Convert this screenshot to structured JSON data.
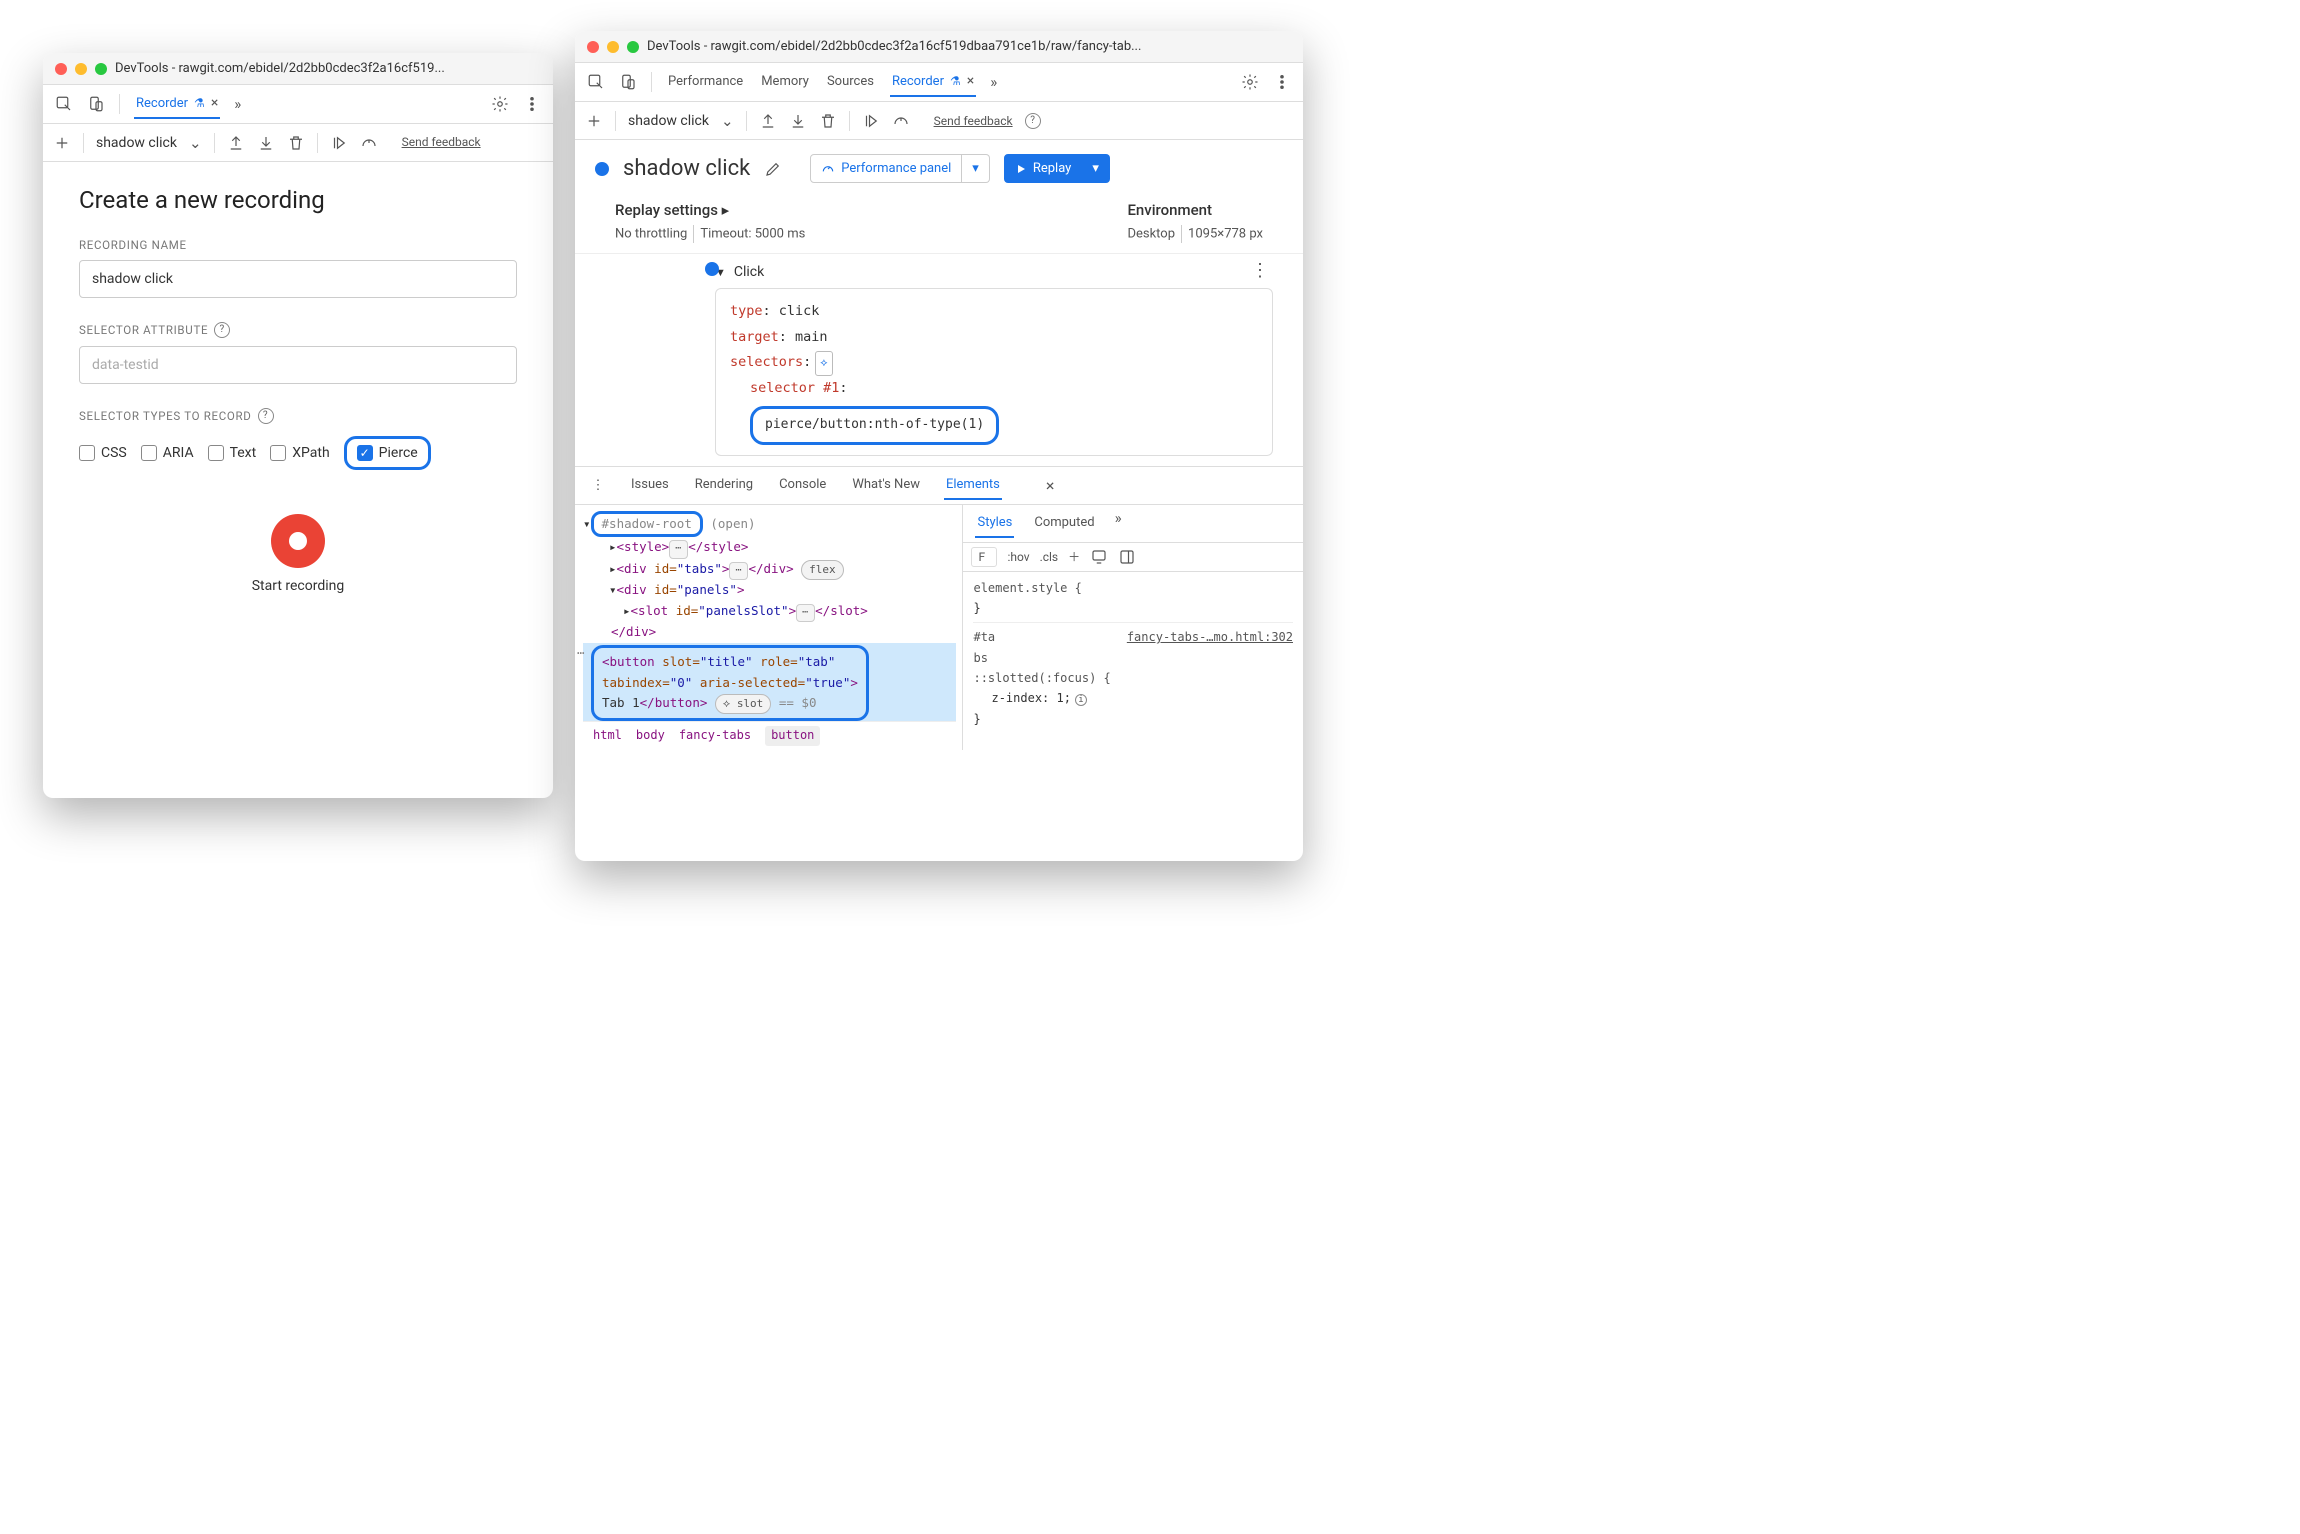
{
  "left": {
    "title": "DevTools - rawgit.com/ebidel/2d2bb0cdec3f2a16cf519...",
    "tab_recorder": "Recorder",
    "subbar_title": "shadow click",
    "send_feedback": "Send feedback",
    "heading": "Create a new recording",
    "label_recording_name": "RECORDING NAME",
    "recording_name_value": "shadow click",
    "label_selector_attr": "SELECTOR ATTRIBUTE",
    "selector_attr_placeholder": "data-testid",
    "label_selector_types": "SELECTOR TYPES TO RECORD",
    "types": {
      "css": "CSS",
      "aria": "ARIA",
      "text": "Text",
      "xpath": "XPath",
      "pierce": "Pierce"
    },
    "start": "Start recording"
  },
  "right": {
    "title": "DevTools - rawgit.com/ebidel/2d2bb0cdec3f2a16cf519dbaa791ce1b/raw/fancy-tab...",
    "tabs": {
      "performance": "Performance",
      "memory": "Memory",
      "sources": "Sources",
      "recorder": "Recorder"
    },
    "subbar_title": "shadow click",
    "send_feedback": "Send feedback",
    "rec_name": "shadow click",
    "perf_panel": "Performance panel",
    "replay": "Replay",
    "replay_settings": "Replay settings",
    "no_throttling": "No throttling",
    "timeout": "Timeout: 5000 ms",
    "environment": "Environment",
    "env_desktop": "Desktop",
    "env_dims": "1095×778 px",
    "step_name": "Click",
    "step": {
      "type_k": "type",
      "type_v": ": click",
      "target_k": "target",
      "target_v": ": main",
      "selectors_k": "selectors",
      "selectors_v": ":",
      "sel1_k": "selector #1",
      "sel1_v": ":",
      "sel1_value": "pierce/button:nth-of-type(1)"
    },
    "drawer_tabs": {
      "issues": "Issues",
      "rendering": "Rendering",
      "console": "Console",
      "whatsnew": "What's New",
      "elements": "Elements"
    },
    "dom": {
      "shadow_root": "#shadow-root",
      "shadow_open": "(open)",
      "style_open": "<style>",
      "style_close": "</style>",
      "tabs_open_a": "<div ",
      "tabs_id_k": "id=",
      "tabs_id_v": "\"tabs\"",
      "tabs_close": "></div>",
      "flex_badge": "flex",
      "panels_open_a": "<div ",
      "panels_id_v": "\"panels\"",
      "panels_open_close": ">",
      "slot_open": "<slot ",
      "slot_id_v": "\"panelsSlot\"",
      "slot_close": "></slot>",
      "div_close": "</div>",
      "btn_open": "<button ",
      "btn_slot_k": "slot=",
      "btn_slot_v": "\"title\"",
      "btn_role_k": "role=",
      "btn_role_v": "\"tab\"",
      "btn_tab_k": "tabindex=",
      "btn_tab_v": "\"0\"",
      "btn_aria_k": "aria-selected=",
      "btn_aria_v": "\"true\"",
      "btn_text": "Tab 1",
      "btn_close": "</button>",
      "slot_badge": "slot",
      "eq0": " == $0"
    },
    "crumbs": {
      "html": "html",
      "body": "body",
      "fancy": "fancy-tabs",
      "button": "button"
    },
    "styles": {
      "tab_styles": "Styles",
      "tab_computed": "Computed",
      "filter": "F",
      "hov": ":hov",
      "cls": ".cls",
      "elstyle": "element.style {",
      "brace": "}",
      "sel_ta": "#ta",
      "src": "fancy-tabs-…mo.html:302",
      "sel_bs": "bs",
      "slotted": "::slotted(:focus) {",
      "zindex_k": "z-index",
      "zindex_v": ": 1;"
    }
  }
}
